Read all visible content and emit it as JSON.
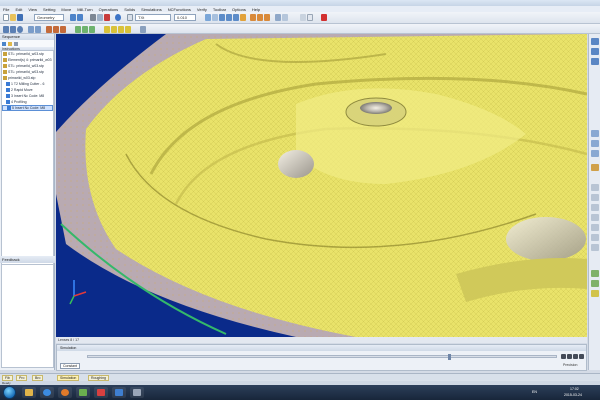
{
  "menu": [
    "File",
    "Edit",
    "View",
    "Setting",
    "Move",
    "Mill-Turn",
    "Operations",
    "Solids",
    "Simulations",
    "NCFunctions",
    "Verify",
    "Toolbar",
    "Options",
    "Help"
  ],
  "toolbar": {
    "combo1": "Geometry",
    "combo2": "TXt",
    "combo3": "0.010"
  },
  "sequence_label": "Sequence",
  "instructions_label": "Instructions",
  "tree": [
    {
      "text": "STL: primarild_w03.stp",
      "color": "#c8a23c"
    },
    {
      "text": "Element(s) 4: primarild_w03",
      "color": "#c8a23c"
    },
    {
      "text": "STL: primarild_w03.stp",
      "color": "#c8a23c"
    },
    {
      "text": "STL: primarild_w03.stp",
      "color": "#c8a23c"
    },
    {
      "text": "primarild_w03.stp",
      "color": "#c8a23c"
    },
    {
      "text": "1 T2 Milling Cutter - 6",
      "color": "#3a7bd5"
    },
    {
      "text": "2 Rapid Move",
      "color": "#3a7bd5"
    },
    {
      "text": "3 Insert Nc Code: M8",
      "color": "#3a7bd5"
    },
    {
      "text": "4 Profiling",
      "color": "#3a7bd5"
    },
    {
      "text": "5 Insert Nc Code: M8",
      "color": "#3a7bd5",
      "selected": true
    }
  ],
  "feedback_label": "Feedback",
  "status_text": "Lenses 8 / 17",
  "simulation": {
    "header": "Simulation",
    "button": "Constant",
    "position": "Precision",
    "progress": 0.77
  },
  "bottom_tabs": [
    "Fib",
    "Pro",
    "Bro",
    "Simulation",
    "Roughing"
  ],
  "ready_text": "Ready",
  "tray": {
    "time": "17:02",
    "date": "2015-03-24",
    "lang": "EN"
  },
  "colors": {
    "model": "#e9e36a",
    "base": "#b9aab2",
    "background": "#0a2a8a",
    "accent_edge": "#34b86a"
  }
}
